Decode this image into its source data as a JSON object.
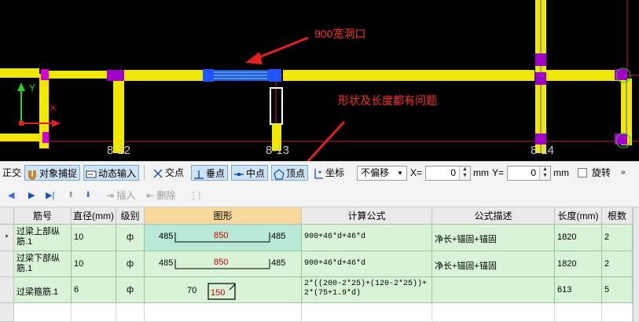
{
  "cad": {
    "annotation_opening": "900宽洞口",
    "annotation_problem": "形状及长度都有问题",
    "axis_y": "Y",
    "axis_x": "X",
    "axis_labels": [
      "8-12",
      "8-13",
      "8-14"
    ]
  },
  "snap_toolbar": {
    "ortho": "正交",
    "object_snap": "对象捕捉",
    "dynamic_input": "动态输入",
    "intersection": "交点",
    "perpendicular": "垂点",
    "midpoint": "中点",
    "vertex": "顶点",
    "coordinate": "坐标",
    "offset_select": "不偏移",
    "x_label": "X=",
    "x_value": "0",
    "x_unit": "mm",
    "y_label": "Y=",
    "y_value": "0",
    "y_unit": "mm",
    "rotate": "旋转"
  },
  "grid_toolbar": {
    "insert": "插入",
    "delete": "删除"
  },
  "table": {
    "columns": [
      "筋号",
      "直径(mm)",
      "级别",
      "图形",
      "计算公式",
      "公式描述",
      "长度(mm)",
      "根数"
    ],
    "rows": [
      {
        "marker": "*",
        "name": "过梁上部纵筋.1",
        "diameter": "10",
        "grade": "ф",
        "shape": {
          "left": "485",
          "mid": "850",
          "right": "485"
        },
        "formula": "900+46*d+46*d",
        "description": "净长+锚固+锚固",
        "length": "1820",
        "count": "2"
      },
      {
        "marker": "",
        "name": "过梁下部纵筋.1",
        "diameter": "10",
        "grade": "ф",
        "shape": {
          "left": "485",
          "mid": "850",
          "right": "485"
        },
        "formula": "900+46*d+46*d",
        "description": "净长+锚固+锚固",
        "length": "1820",
        "count": "2"
      },
      {
        "marker": "",
        "name": "过梁箍筋.1",
        "diameter": "6",
        "grade": "ф",
        "shape": {
          "left": "70",
          "mid": "150"
        },
        "formula": "2*((200-2*25)+(120-2*25))+2*(75+1.9*d)",
        "description": "",
        "length": "613",
        "count": "5"
      }
    ]
  }
}
